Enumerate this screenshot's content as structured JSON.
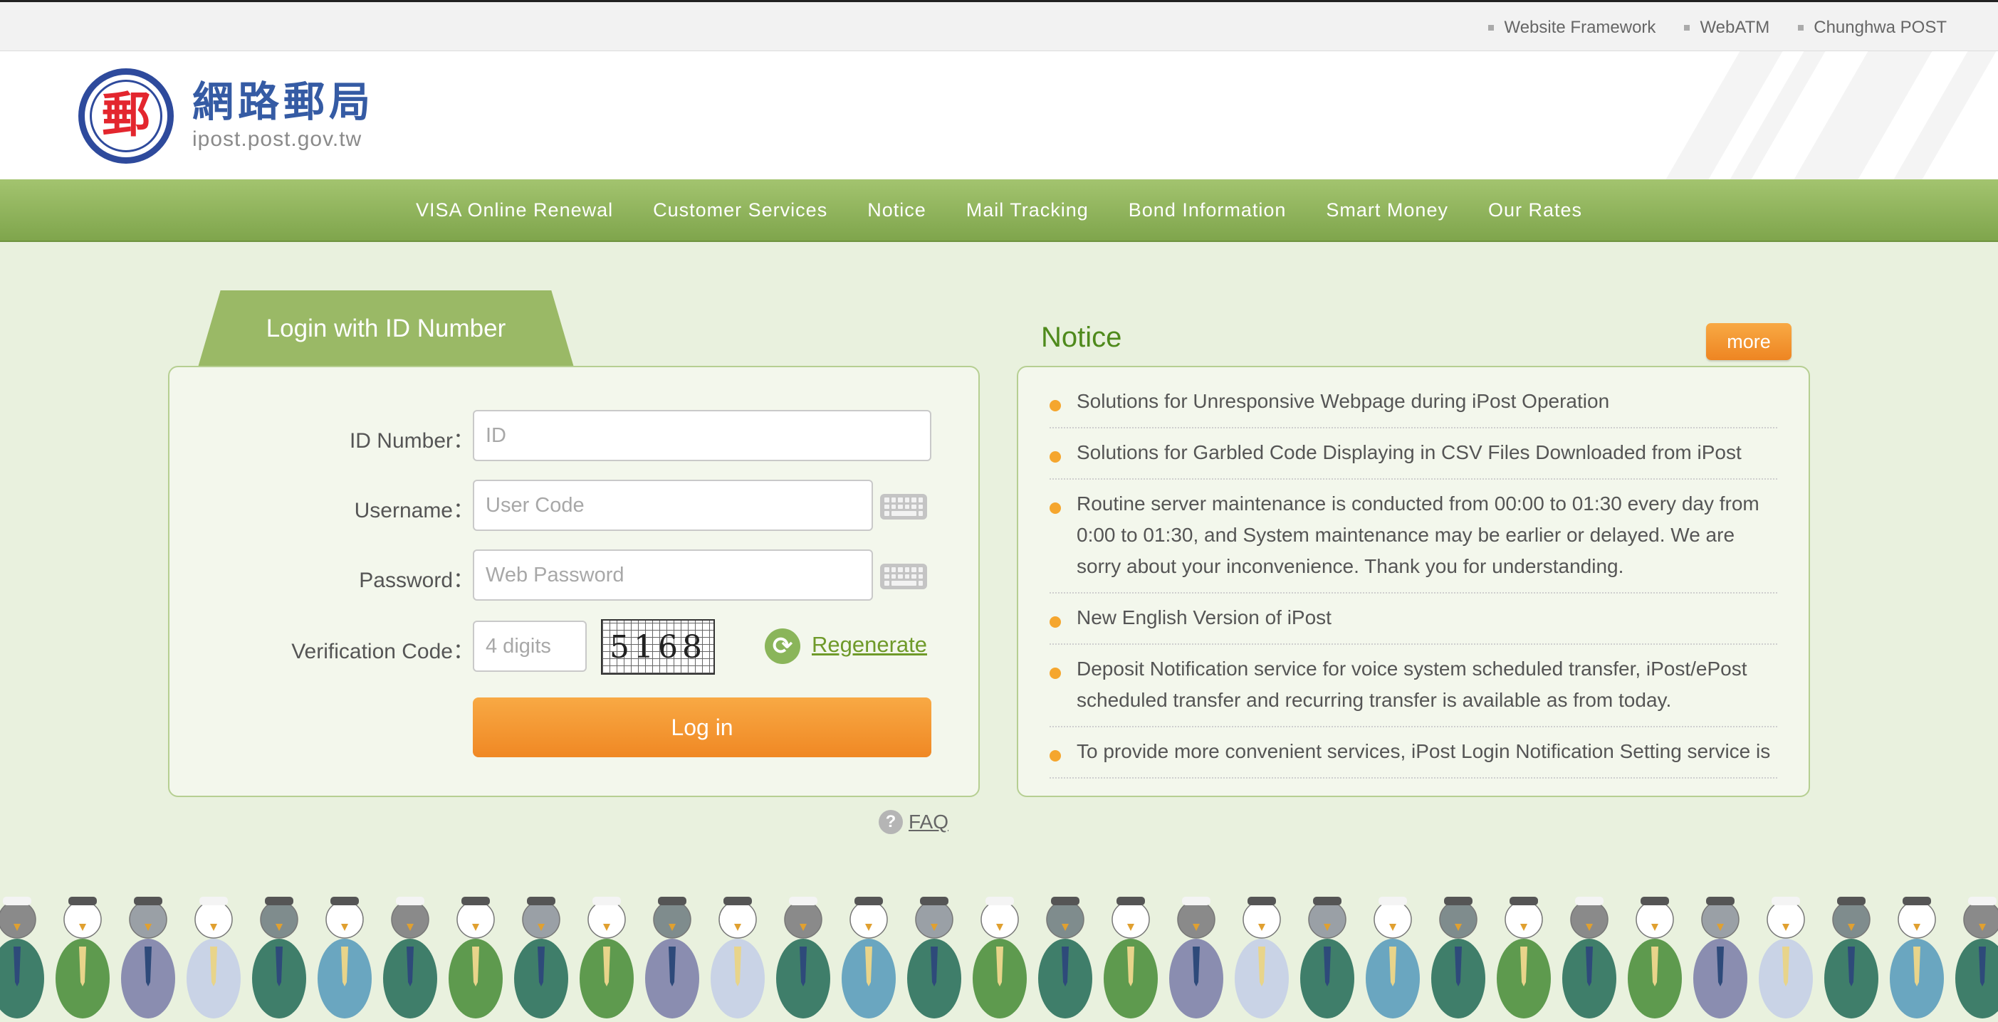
{
  "toplinks": [
    "Website Framework",
    "WebATM",
    "Chunghwa POST"
  ],
  "logo": {
    "glyph": "郵",
    "chinese": "網路郵局",
    "domain": "ipost.post.gov.tw"
  },
  "nav": [
    "VISA Online Renewal",
    "Customer Services",
    "Notice",
    "Mail Tracking",
    "Bond Information",
    "Smart Money",
    "Our Rates"
  ],
  "login": {
    "tab_label": "Login with ID Number",
    "id_label": "ID Number：",
    "id_placeholder": "ID",
    "username_label": "Username：",
    "username_placeholder": "User Code",
    "password_label": "Password：",
    "password_placeholder": "Web Password",
    "verify_label": "Verification Code：",
    "verify_placeholder": "4 digits",
    "captcha": "5168",
    "regenerate": "Regenerate",
    "login_button": "Log in",
    "faq": "FAQ"
  },
  "notice": {
    "title": "Notice",
    "more": "more",
    "items": [
      "Solutions for Unresponsive Webpage during iPost Operation",
      "Solutions for Garbled Code Displaying in CSV Files Downloaded from iPost",
      "Routine server maintenance is conducted from 00:00 to 01:30 every day from 0:00 to 01:30, and System maintenance may be earlier or delayed. We are sorry about your inconvenience. Thank you for understanding.",
      "New English Version of iPost",
      "Deposit Notification service for voice system scheduled transfer, iPost/ePost scheduled transfer and recurring transfer is available as from today.",
      "To provide more convenient services, iPost Login Notification Setting service is"
    ]
  },
  "colors": {
    "nav_green": "#8fb35a",
    "accent_orange": "#f29531",
    "notice_green": "#4f8a1c",
    "panel_bg": "#f3f7ec",
    "logo_blue": "#2e4a9c",
    "logo_red": "#e3262e"
  },
  "icons": [
    "keyboard-icon",
    "refresh-icon",
    "question-icon",
    "bullet-icon"
  ]
}
